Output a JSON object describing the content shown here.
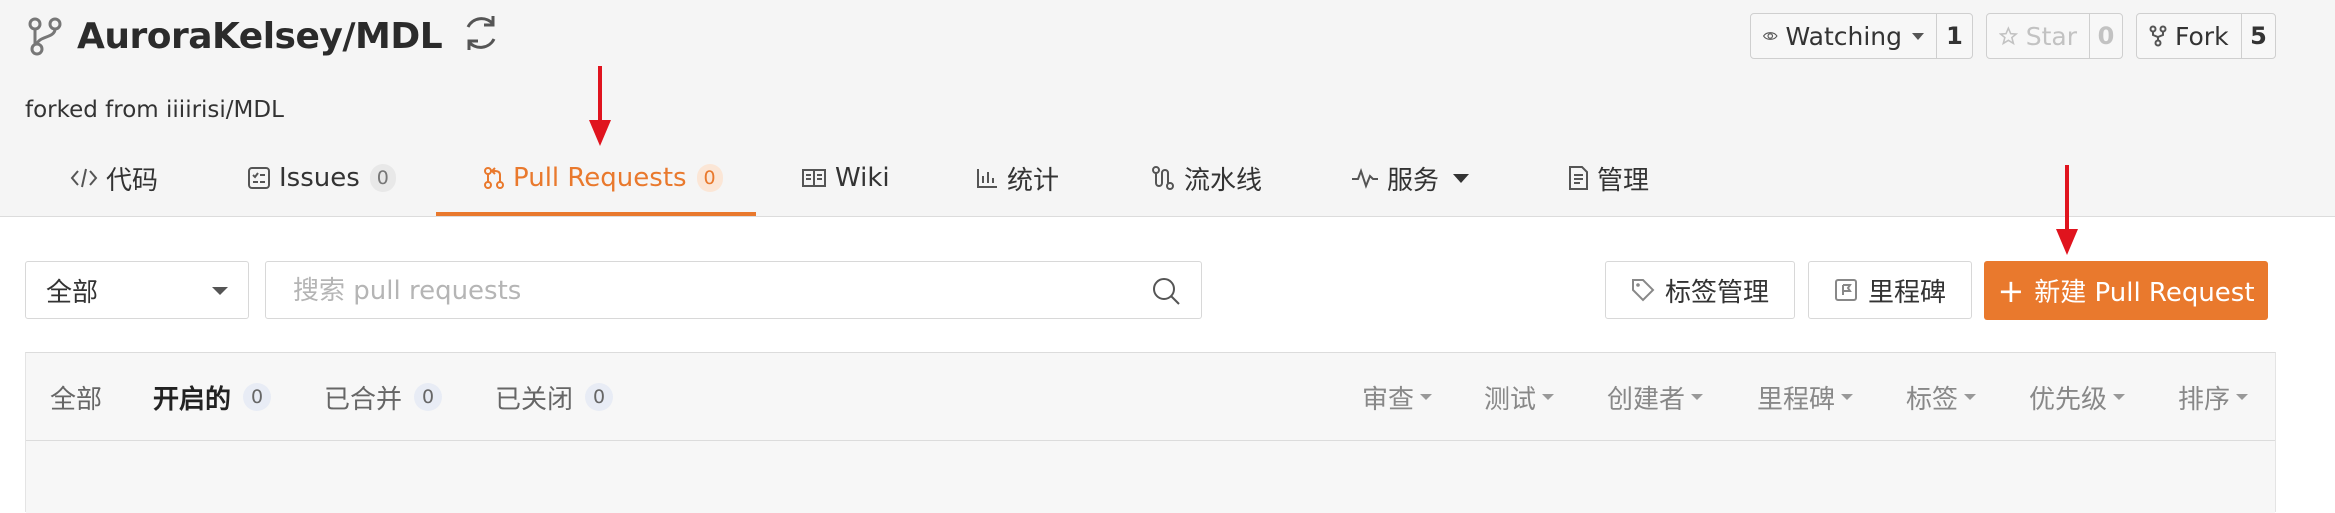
{
  "repo": {
    "name": "AuroraKelsey/MDL",
    "forked_from": "forked from iiiirisi/MDL"
  },
  "actions": {
    "watch": {
      "label": "Watching",
      "count": "1"
    },
    "star": {
      "label": "Star",
      "count": "0"
    },
    "fork": {
      "label": "Fork",
      "count": "5"
    }
  },
  "tabs": [
    {
      "label": "代码",
      "icon": "code-icon"
    },
    {
      "label": "Issues",
      "badge": "0",
      "icon": "issues-icon"
    },
    {
      "label": "Pull Requests",
      "badge": "0",
      "icon": "pull-request-icon",
      "active": true
    },
    {
      "label": "Wiki",
      "icon": "wiki-icon"
    },
    {
      "label": "统计",
      "icon": "chart-icon"
    },
    {
      "label": "流水线",
      "icon": "pipeline-icon"
    },
    {
      "label": "服务",
      "icon": "pulse-icon"
    },
    {
      "label": "管理",
      "icon": "manage-icon"
    }
  ],
  "toolbar": {
    "filter_value": "全部",
    "search_placeholder": "搜索 pull requests",
    "labels_button": "标签管理",
    "milestone_button": "里程碑",
    "new_pr_button": "新建 Pull Request"
  },
  "list": {
    "state_tabs": [
      {
        "label": "全部"
      },
      {
        "label": "开启的",
        "badge": "0",
        "active": true
      },
      {
        "label": "已合并",
        "badge": "0"
      },
      {
        "label": "已关闭",
        "badge": "0"
      }
    ],
    "filters": [
      "审查",
      "测试",
      "创建者",
      "里程碑",
      "标签",
      "优先级",
      "排序"
    ]
  },
  "colors": {
    "accent": "#e9792d",
    "annotation_arrow": "#e0141e",
    "header_bg": "#f5f5f5"
  }
}
